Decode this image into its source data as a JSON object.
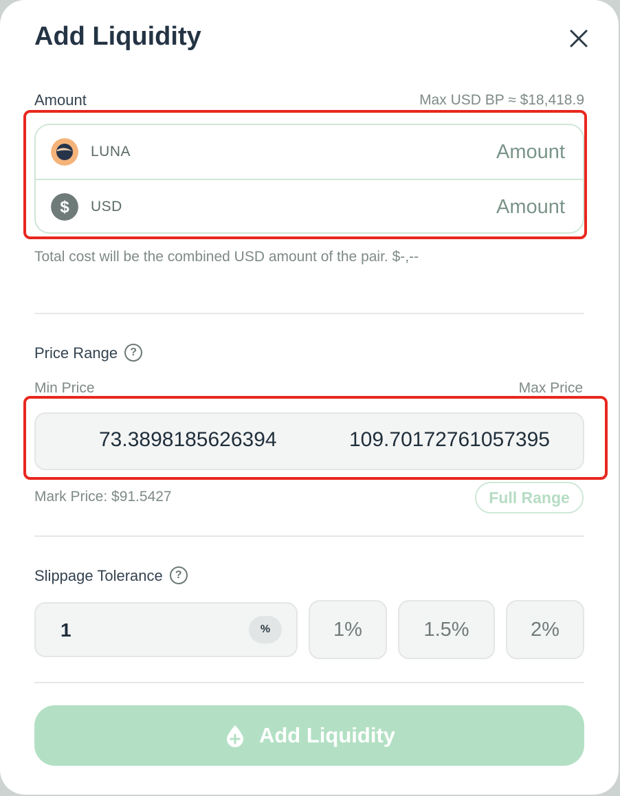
{
  "modal": {
    "title": "Add Liquidity"
  },
  "amount": {
    "label": "Amount",
    "max_bp": "Max USD BP ≈ $18,418.9",
    "tokens": [
      {
        "name": "LUNA",
        "placeholder": "Amount",
        "icon": "luna-token-icon"
      },
      {
        "name": "USD",
        "placeholder": "Amount",
        "icon": "usd-token-icon"
      }
    ],
    "total_cost_note": "Total cost will be the combined USD amount of the pair. $-,--"
  },
  "price_range": {
    "label": "Price Range",
    "help_glyph": "?",
    "min_label": "Min Price",
    "max_label": "Max Price",
    "min_value": "73.3898185626394",
    "max_value": "109.70172761057395",
    "mark_price": "Mark Price: $91.5427",
    "full_range_label": "Full Range"
  },
  "slippage": {
    "label": "Slippage Tolerance",
    "help_glyph": "?",
    "value": "1",
    "unit": "%",
    "presets": [
      "1%",
      "1.5%",
      "2%"
    ]
  },
  "submit": {
    "label": "Add Liquidity",
    "icon": "liquidity-drop-icon"
  },
  "colors": {
    "accent_green": "#b3e0c4",
    "highlight_red": "#e8271f",
    "title": "#243444"
  }
}
